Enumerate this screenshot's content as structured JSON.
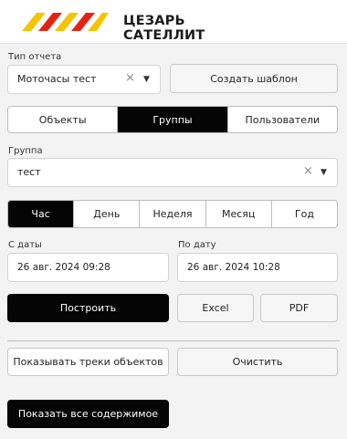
{
  "brand": {
    "line1": "ЦЕЗАРЬ",
    "line2": "САТЕЛЛИТ"
  },
  "report_type": {
    "label": "Тип отчета",
    "value": "Моточасы тест",
    "clear": "×",
    "caret": "▼"
  },
  "create_template_label": "Создать шаблон",
  "target_tabs": [
    {
      "label": "Объекты",
      "active": false
    },
    {
      "label": "Группы",
      "active": true
    },
    {
      "label": "Пользователи",
      "active": false
    }
  ],
  "group": {
    "label": "Группа",
    "value": "тест",
    "clear": "×",
    "caret": "▼"
  },
  "period_tabs": [
    {
      "label": "Час",
      "active": true
    },
    {
      "label": "День",
      "active": false
    },
    {
      "label": "Неделя",
      "active": false
    },
    {
      "label": "Месяц",
      "active": false
    },
    {
      "label": "Год",
      "active": false
    }
  ],
  "date_from": {
    "label": "С даты",
    "value": "26 авг. 2024 09:28"
  },
  "date_to": {
    "label": "По дату",
    "value": "26 авг. 2024 10:28"
  },
  "actions": {
    "build": "Построить",
    "excel": "Excel",
    "pdf": "PDF"
  },
  "show_tracks_label": "Показывать треки объектов",
  "clear_label": "Очистить",
  "show_all_label": "Показать все содержимое",
  "colors": {
    "accent_yellow": "#F5C400",
    "accent_red": "#E42313",
    "dark": "#050505"
  }
}
